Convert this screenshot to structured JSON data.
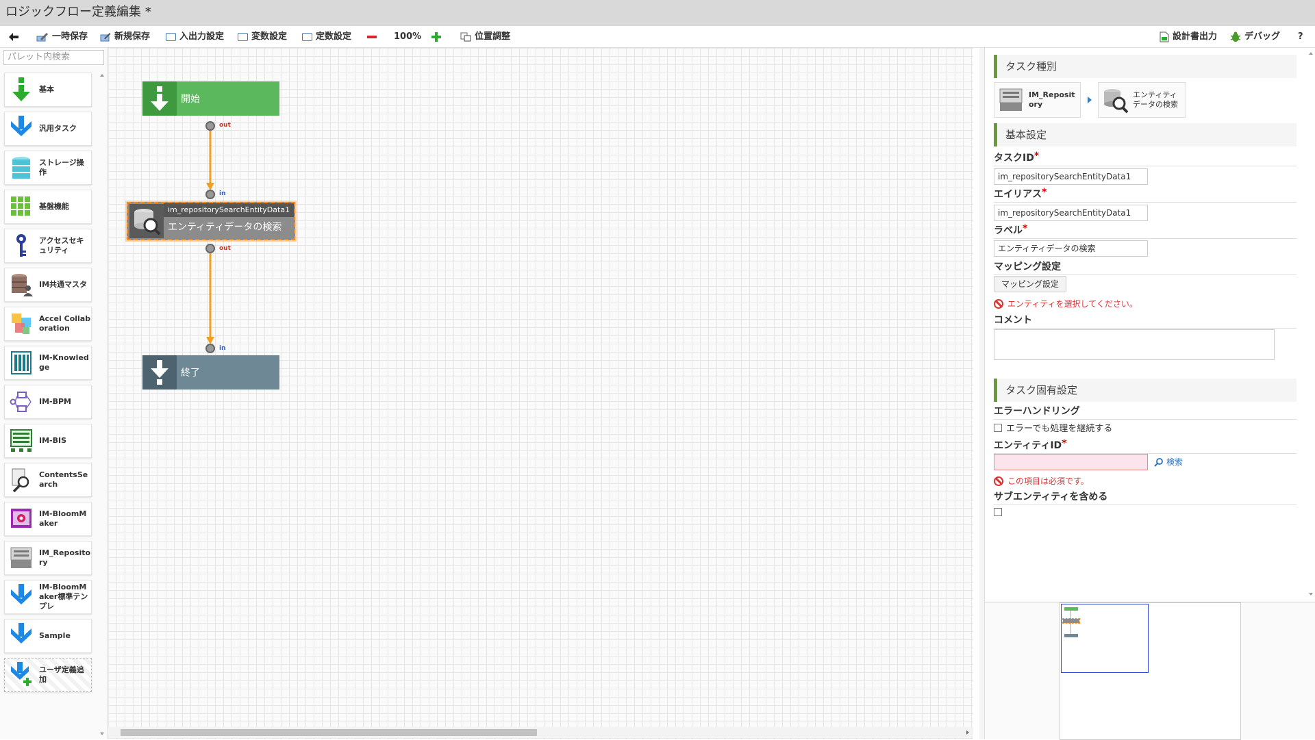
{
  "window": {
    "title": "ロジックフロー定義編集 *"
  },
  "toolbar": {
    "back_label": "",
    "temp_save": "一時保存",
    "new_save": "新規保存",
    "io_settings": "入出力設定",
    "var_settings": "変数設定",
    "const_settings": "定数設定",
    "zoom_level": "100%",
    "position_adjust": "位置調整",
    "design_doc_output": "設計書出力",
    "debug": "デバッグ",
    "help": "?"
  },
  "palette": {
    "search_placeholder": "パレット内検索",
    "items": [
      {
        "label": "基本",
        "icon": "arrow-down-green-icon"
      },
      {
        "label": "汎用タスク",
        "icon": "arrow-down-blue-icon"
      },
      {
        "label": "ストレージ操作",
        "icon": "storage-icon"
      },
      {
        "label": "基盤機能",
        "icon": "grid-blocks-icon"
      },
      {
        "label": "アクセスセキュリティ",
        "icon": "key-icon"
      },
      {
        "label": "IM共通マスタ",
        "icon": "database-user-icon"
      },
      {
        "label": "Accel Collaboration",
        "icon": "collaboration-icon"
      },
      {
        "label": "IM-Knowledge",
        "icon": "knowledge-icon"
      },
      {
        "label": "IM-BPM",
        "icon": "bpm-icon"
      },
      {
        "label": "IM-BIS",
        "icon": "bis-icon"
      },
      {
        "label": "ContentsSearch",
        "icon": "contents-search-icon"
      },
      {
        "label": "IM-BloomMaker",
        "icon": "bloommaker-icon"
      },
      {
        "label": "IM_Repository",
        "icon": "repository-icon"
      },
      {
        "label": "IM-BloomMaker標準テンプレ",
        "icon": "arrow-down-blue-icon"
      },
      {
        "label": "Sample",
        "icon": "arrow-down-blue-icon"
      },
      {
        "label": "ユーザ定義追加",
        "icon": "arrow-down-add-icon"
      }
    ]
  },
  "flow": {
    "start_node": {
      "label": "開始",
      "port_out": "out"
    },
    "task_node": {
      "id": "im_repositorySearchEntityData1",
      "label": "エンティティデータの検索",
      "port_in": "in",
      "port_out": "out"
    },
    "end_node": {
      "label": "終了",
      "port_in": "in"
    }
  },
  "properties": {
    "task_type_header": "タスク種別",
    "task_type_category": "IM_Repository",
    "task_type_name": "エンティティデータの検索",
    "basic_header": "基本設定",
    "task_id_label": "タスクID",
    "task_id_value": "im_repositorySearchEntityData1",
    "alias_label": "エイリアス",
    "alias_value": "im_repositorySearchEntityData1",
    "label_label": "ラベル",
    "label_value": "エンティティデータの検索",
    "mapping_label": "マッピング設定",
    "mapping_button": "マッピング設定",
    "mapping_error": "エンティティを選択してください。",
    "comment_label": "コメント",
    "comment_value": "",
    "specific_header": "タスク固有設定",
    "error_handling_label": "エラーハンドリング",
    "continue_on_error": "エラーでも処理を継続する",
    "entity_id_label": "エンティティID",
    "entity_id_value": "",
    "search_link": "検索",
    "entity_id_error": "この項目は必須です。",
    "include_sub_label": "サブエンティティを含める"
  },
  "colors": {
    "start_green": "#5cb85c",
    "task_gray": "#8c8c8c",
    "end_gray": "#6f8896",
    "connector_orange": "#f0a020",
    "selection_orange": "#ff8c1a",
    "section_green": "#6a9a3a",
    "error_red": "#d33",
    "link_blue": "#2a6fb5"
  }
}
